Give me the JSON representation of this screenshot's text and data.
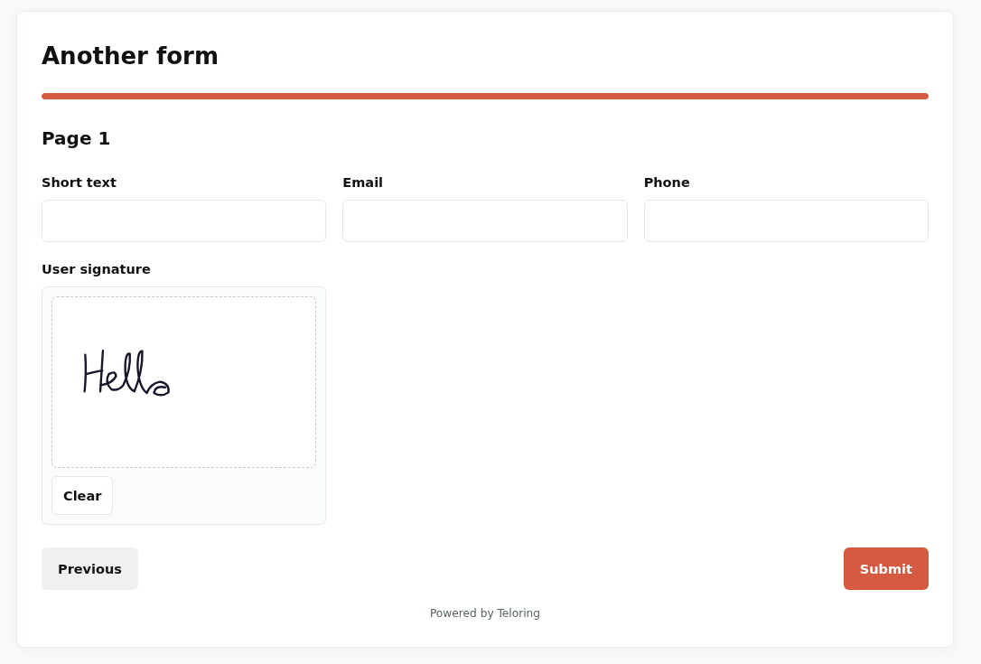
{
  "form": {
    "title": "Another form",
    "progress": {
      "level": 1
    },
    "page_title": "Page 1",
    "fields": [
      {
        "kind": "text",
        "label": "Short text"
      },
      {
        "kind": "text",
        "label": "Email"
      },
      {
        "kind": "text",
        "label": "Phone"
      },
      {
        "kind": "signature",
        "label": "User signature",
        "signed": true,
        "clear_button": "Clear"
      }
    ],
    "buttons": [
      {
        "kind": "secondary",
        "label": "Previous"
      },
      {
        "kind": "primary",
        "label": "Submit"
      }
    ],
    "footer": "Powered by Teloring"
  }
}
